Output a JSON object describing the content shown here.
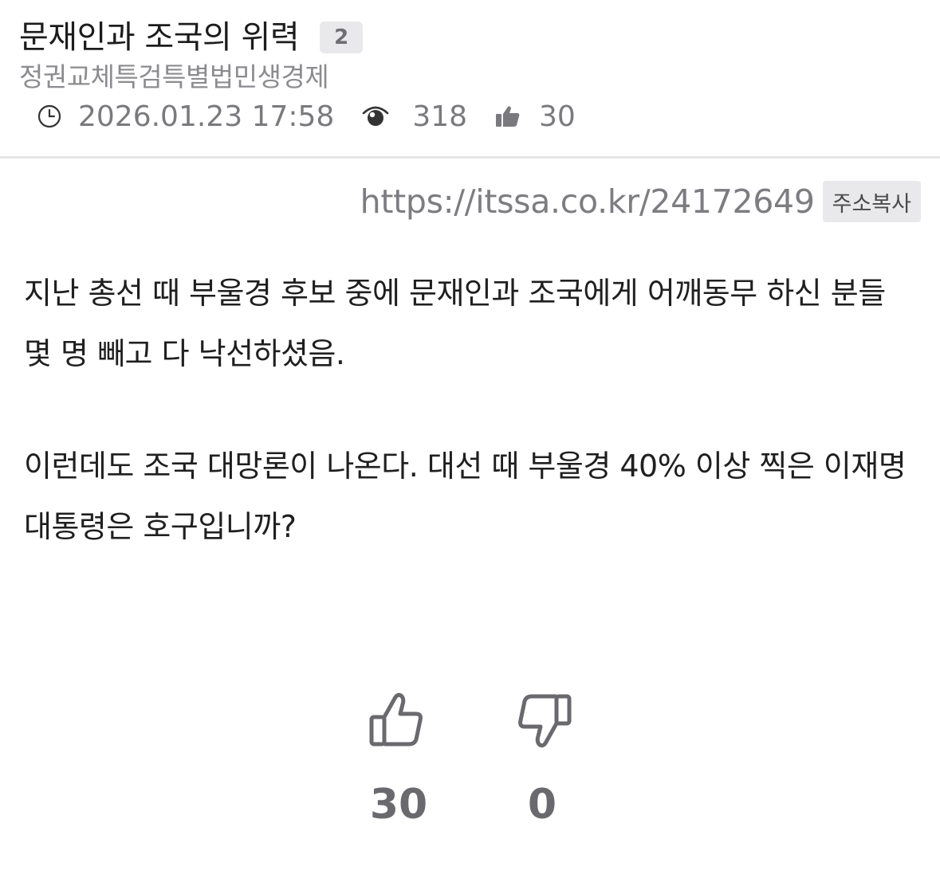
{
  "post": {
    "title": "문재인과 조국의 위력",
    "comment_count": "2",
    "category": "정권교체특검특별법민생경제",
    "datetime": "2026.01.23 17:58",
    "views": "318",
    "likes": "30"
  },
  "url_bar": {
    "url": "https://itssa.co.kr/24172649",
    "copy_label": "주소복사"
  },
  "content": {
    "paragraphs": [
      "지난 총선 때 부울경 후보 중에 문재인과 조국에게 어깨동무 하신 분들 몇 명 빼고 다 낙선하셨음.",
      "이런데도 조국 대망론이 나온다. 대선 때 부울경 40% 이상 찍은 이재명 대통령은 호구입니까?"
    ]
  },
  "votes": {
    "up_count": "30",
    "down_count": "0"
  },
  "icons": {
    "clock": "clock-icon",
    "views": "eye-icon",
    "likes": "thumbs-up-icon",
    "vote_up": "thumbs-up-icon",
    "vote_down": "thumbs-down-icon"
  },
  "colors": {
    "text": "#1f1f1f",
    "muted": "#7a7a7e",
    "badge_bg": "#e9e9eb",
    "divider": "#e6e6e8"
  }
}
